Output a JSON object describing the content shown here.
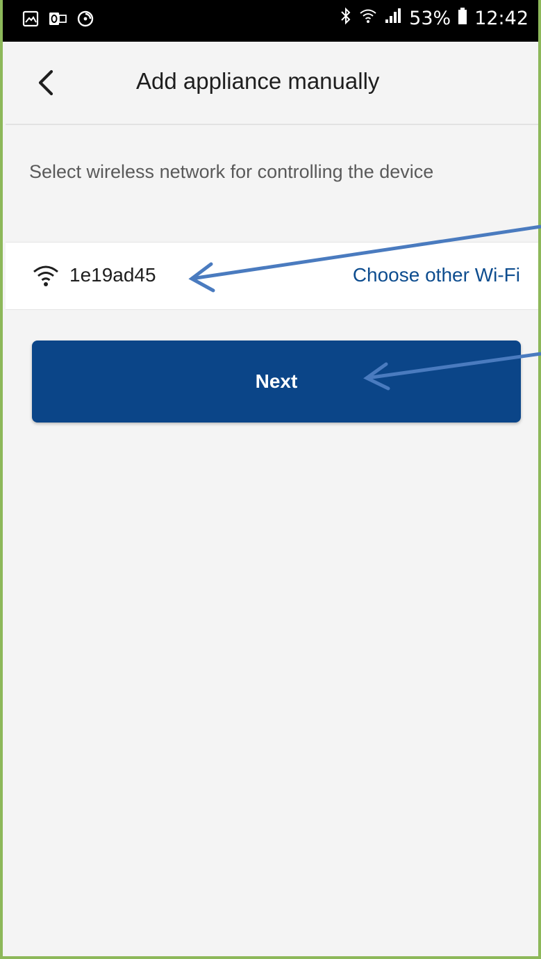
{
  "status_bar": {
    "battery_percent": "53%",
    "time": "12:42",
    "left_icons": [
      "gallery-icon",
      "outlook-icon",
      "sync-icon"
    ],
    "right_icons": [
      "bluetooth-icon",
      "wifi-icon",
      "signal-icon",
      "battery-icon"
    ]
  },
  "header": {
    "title": "Add appliance manually",
    "back_icon": "chevron-left-icon"
  },
  "main": {
    "instruction": "Select wireless network for controlling the device",
    "wifi": {
      "ssid": "1e19ad45",
      "choose_other_label": "Choose other Wi-Fi",
      "icon": "wifi-icon"
    },
    "next_label": "Next"
  },
  "colors": {
    "primary": "#0b4588",
    "link": "#0e4d8f",
    "background": "#f4f4f4",
    "frame_border": "#8db85a",
    "annotation_arrow": "#4a7bbf"
  }
}
